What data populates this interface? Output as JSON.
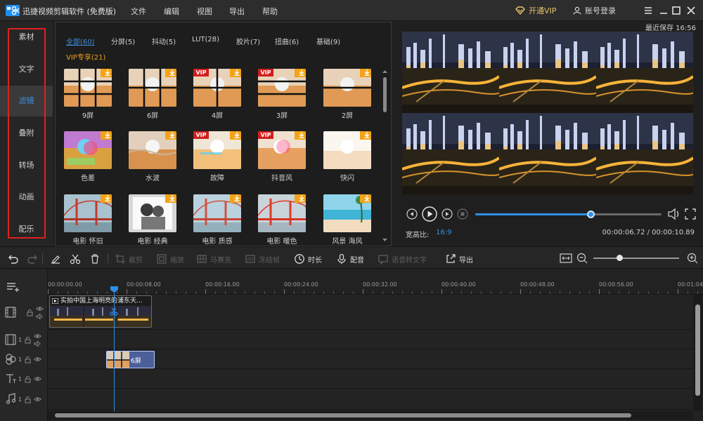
{
  "window": {
    "title": "迅捷视频剪辑软件 (免费版)",
    "menu": [
      "文件",
      "编辑",
      "视图",
      "导出",
      "帮助"
    ],
    "vip_label": "开通VIP",
    "login_label": "账号登录"
  },
  "left_nav": {
    "items": [
      "素材",
      "文字",
      "滤镜",
      "叠附",
      "转场",
      "动画",
      "配乐"
    ],
    "active_index": 2
  },
  "filter_panel": {
    "categories": [
      "全部(60)",
      "分屏(5)",
      "抖动(5)",
      "LUT(28)",
      "胶片(7)",
      "扭曲(6)",
      "基础(9)"
    ],
    "vip_category": "VIP专享(21)",
    "active_category_index": 0,
    "items": [
      {
        "label": "9屏",
        "vip": false,
        "thumb": "cat-9"
      },
      {
        "label": "6屏",
        "vip": false,
        "thumb": "cat-6"
      },
      {
        "label": "4屏",
        "vip": true,
        "thumb": "cat-4"
      },
      {
        "label": "3屏",
        "vip": true,
        "thumb": "cat-3"
      },
      {
        "label": "2屏",
        "vip": false,
        "thumb": "cat-2"
      },
      {
        "label": "色差",
        "vip": false,
        "thumb": "cat-color"
      },
      {
        "label": "水波",
        "vip": false,
        "thumb": "cat-wave"
      },
      {
        "label": "故障",
        "vip": true,
        "thumb": "cat-glitch"
      },
      {
        "label": "抖音风",
        "vip": true,
        "thumb": "cat-tiktok"
      },
      {
        "label": "快闪",
        "vip": false,
        "thumb": "cat-flash"
      },
      {
        "label": "电影 怀旧",
        "vip": false,
        "thumb": "bridge-warm"
      },
      {
        "label": "电影 经典",
        "vip": false,
        "thumb": "couple"
      },
      {
        "label": "电影 质感",
        "vip": false,
        "thumb": "bridge-soft"
      },
      {
        "label": "电影 暖色",
        "vip": false,
        "thumb": "bridge-red"
      },
      {
        "label": "风景 海风",
        "vip": false,
        "thumb": "beach"
      }
    ],
    "vip_badge": "VIP"
  },
  "preview": {
    "save_info": "最近保存 16:56",
    "progress_fraction": 0.62,
    "ratio_label": "宽高比:",
    "ratio_value": "16:9",
    "time_readout": "00:00:06.72 / 00:00:10.89"
  },
  "toolbar": {
    "tools": [
      {
        "name": "undo-button",
        "label": "",
        "enabled": true
      },
      {
        "name": "redo-button",
        "label": "",
        "enabled": false
      },
      {
        "name": "edit-button",
        "label": "",
        "enabled": true
      },
      {
        "name": "cut-button",
        "label": "",
        "enabled": true
      },
      {
        "name": "delete-button",
        "label": "",
        "enabled": true
      },
      {
        "name": "crop-button",
        "label": "裁剪",
        "enabled": false
      },
      {
        "name": "zoom-tool-button",
        "label": "缩放",
        "enabled": false
      },
      {
        "name": "mosaic-button",
        "label": "马赛克",
        "enabled": false
      },
      {
        "name": "freeze-button",
        "label": "冻结帧",
        "enabled": false
      },
      {
        "name": "duration-button",
        "label": "时长",
        "enabled": true
      },
      {
        "name": "dub-button",
        "label": "配音",
        "enabled": true
      },
      {
        "name": "speech-to-text-button",
        "label": "语音转文字",
        "enabled": false
      },
      {
        "name": "export-button",
        "label": "导出",
        "enabled": true
      }
    ],
    "zoom_fraction": 0.3
  },
  "timeline": {
    "ruler_ticks": [
      "00:00:00.00",
      "00:00:08.00",
      "00:00:16.00",
      "00:00:24.00",
      "00:00:32.00",
      "00:00:40.00",
      "00:00:48.00",
      "00:00:56.00",
      "00:01:04"
    ],
    "video_clip_title": "实拍中国上海明亮的浦东天...",
    "filter_clip_label": "6屏",
    "track_numbers": [
      "1",
      "1",
      "1",
      "1"
    ]
  },
  "colors": {
    "accent": "#2f8fe8",
    "vip": "#e8a020",
    "vip_badge": "#d21d1d",
    "highlight_box": "#e02020"
  }
}
